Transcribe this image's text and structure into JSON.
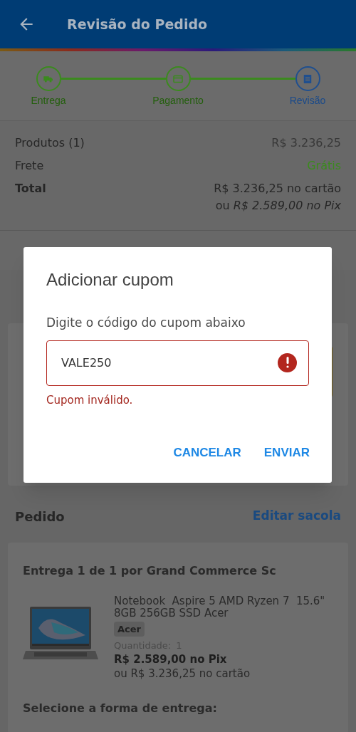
{
  "header": {
    "title": "Revisão do Pedido"
  },
  "steps": [
    {
      "label": "Entrega",
      "selected": false
    },
    {
      "label": "Pagamento",
      "selected": false
    },
    {
      "label": "Revisão",
      "selected": true
    }
  ],
  "summary": {
    "rows": [
      {
        "label": "Produtos (1)",
        "value": "R$ 3.236,25",
        "kind": "plain"
      },
      {
        "label": "Frete",
        "value": "Grátis",
        "kind": "free"
      }
    ],
    "total": {
      "label": "Total",
      "card_line": "R$ 3.236,25 no cartão",
      "pix_line": "ou *R$ 2.589,00 no Pix*"
    }
  },
  "order": {
    "title": "Pedido",
    "edit_link": "Editar sacola",
    "shipment_title": "Entrega 1 de 1 por Grand Commerce Sc",
    "product": {
      "name": "Notebook  Aspire 5 AMD Ryzen 7  15.6\" 8GB 256GB SSD Acer",
      "brand": "Acer",
      "quantity_label": "Quantidade:",
      "quantity": "1",
      "pix_price": "R$ 2.589,00 no Pix",
      "card_price": "ou R$ 3.236,25 no cartão"
    },
    "delivery_prompt": "Selecione a forma de entrega:"
  },
  "dialog": {
    "title": "Adicionar cupom",
    "instruction": "Digite o código do cupom abaixo",
    "value": "VALE250",
    "error": true,
    "error_message": "Cupom inválido.",
    "buttons": [
      "CANCELAR",
      "ENVIAR"
    ]
  }
}
